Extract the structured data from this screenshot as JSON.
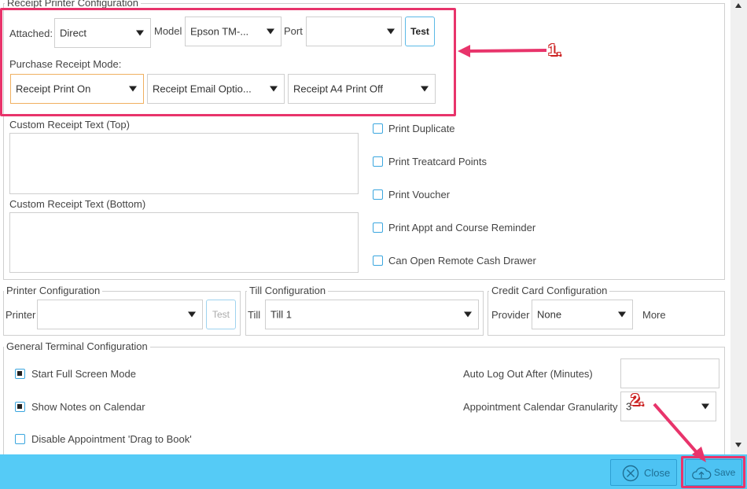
{
  "receipt_printer": {
    "legend": "Receipt Printer Configuration",
    "attached_label": "Attached:",
    "attached_value": "Direct",
    "model_label": "Model",
    "model_value": "Epson TM-...",
    "port_label": "Port",
    "port_value": "",
    "test_label": "Test",
    "mode_label": "Purchase Receipt Mode:",
    "mode_print": "Receipt Print On",
    "mode_email": "Receipt Email Optio...",
    "mode_a4": "Receipt A4 Print Off",
    "custom_top_label": "Custom Receipt Text (Top)",
    "custom_bottom_label": "Custom Receipt Text (Bottom)",
    "checkboxes": [
      {
        "label": "Print Duplicate",
        "checked": false
      },
      {
        "label": "Print Treatcard Points",
        "checked": false
      },
      {
        "label": "Print Voucher",
        "checked": false
      },
      {
        "label": "Print Appt and Course Reminder",
        "checked": false
      },
      {
        "label": "Can Open Remote Cash Drawer",
        "checked": false
      }
    ]
  },
  "printer_config": {
    "legend": "Printer Configuration",
    "printer_label": "Printer",
    "printer_value": "",
    "test_label": "Test"
  },
  "till_config": {
    "legend": "Till Configuration",
    "till_label": "Till",
    "till_value": "Till 1"
  },
  "credit_card": {
    "legend": "Credit Card Configuration",
    "provider_label": "Provider",
    "provider_value": "None",
    "more_label": "More"
  },
  "general": {
    "legend": "General Terminal Configuration",
    "full_screen": {
      "label": "Start Full Screen Mode",
      "checked": true
    },
    "show_notes": {
      "label": "Show Notes on Calendar",
      "checked": true
    },
    "disable_drag": {
      "label": "Disable Appointment 'Drag to Book'",
      "checked": false
    },
    "auto_logout_label": "Auto Log Out After (Minutes)",
    "auto_logout_value": "",
    "granularity_label": "Appointment Calendar Granularity",
    "granularity_value": "3"
  },
  "annotations": {
    "one": "1.",
    "two": "2."
  },
  "footer": {
    "close_label": "Close",
    "save_label": "Save"
  },
  "colors": {
    "highlight": "#e8346b",
    "footer": "#55cbf6",
    "checkbox": "#3aa6df"
  },
  "icons": [
    "dropdown-arrow-icon",
    "close-circle-icon",
    "cloud-upload-icon",
    "scroll-up-icon",
    "scroll-down-icon"
  ]
}
